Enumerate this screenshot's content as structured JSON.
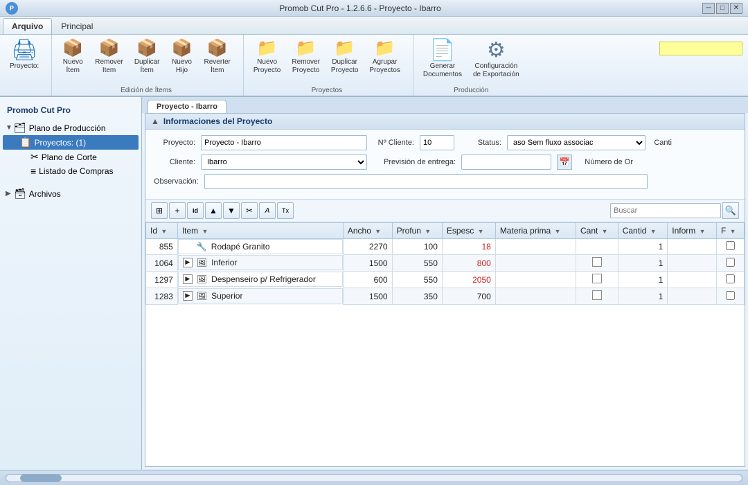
{
  "titleBar": {
    "title": "Promob Cut Pro - 1.2.6.6 - Proyecto - Ibarro",
    "logo": "P",
    "controls": {
      "minimize": "─",
      "restore": "□",
      "close": "✕"
    }
  },
  "menuBar": {
    "tabs": [
      {
        "id": "arquivo",
        "label": "Arquivo",
        "active": true
      },
      {
        "id": "principal",
        "label": "Principal",
        "active": false
      }
    ]
  },
  "ribbon": {
    "sections": [
      {
        "id": "imprimir",
        "label": "",
        "buttons": [
          {
            "id": "imprimir",
            "icon": "🖨",
            "label": "Imprimir",
            "large": true
          }
        ]
      },
      {
        "id": "edicao-items",
        "label": "Edición de Ítems",
        "buttons": [
          {
            "id": "novo-item",
            "icon": "📦",
            "label": "Nuevo\nÍtem"
          },
          {
            "id": "remover-item",
            "icon": "📦",
            "label": "Remover\nItem"
          },
          {
            "id": "duplicar-item",
            "icon": "📦",
            "label": "Duplicar\nÍtem"
          },
          {
            "id": "novo-filho",
            "icon": "📦",
            "label": "Nuevo\nHijo"
          },
          {
            "id": "reverter-item",
            "icon": "📦",
            "label": "Reverter\nÍtem"
          }
        ]
      },
      {
        "id": "proyectos",
        "label": "Proyectos",
        "buttons": [
          {
            "id": "nuevo-proyecto",
            "icon": "📁",
            "label": "Nuevo\nProyecto"
          },
          {
            "id": "remover-proyecto",
            "icon": "📁",
            "label": "Remover\nProyecto"
          },
          {
            "id": "duplicar-proyecto",
            "icon": "📁",
            "label": "Duplicar\nProyecto"
          },
          {
            "id": "agrupar-proyectos",
            "icon": "📁",
            "label": "Agrupar\nProyectos"
          }
        ]
      },
      {
        "id": "produccion",
        "label": "Producción",
        "buttons": [
          {
            "id": "generar-documentos",
            "icon": "📄",
            "label": "Generar\nDocumentos",
            "large": true
          },
          {
            "id": "configuracion-exportacion",
            "icon": "⚙",
            "label": "Configuración\nde Exportación",
            "large": true
          }
        ]
      }
    ],
    "searchPlaceholder": "",
    "searchBg": "#ffff99"
  },
  "sidebar": {
    "title": "Promob Cut Pro",
    "tree": [
      {
        "id": "plano-produccion",
        "label": "Plano de Producción",
        "indent": 0,
        "arrow": "▼",
        "icon": "🗂"
      },
      {
        "id": "proyectos",
        "label": "Proyectos: (1)",
        "indent": 1,
        "arrow": "",
        "icon": "📋",
        "selected": true
      },
      {
        "id": "plano-corte",
        "label": "Plano de Corte",
        "indent": 2,
        "arrow": "",
        "icon": "✂"
      },
      {
        "id": "listado-compras",
        "label": "Listado de Compras",
        "indent": 2,
        "arrow": "",
        "icon": "≡"
      },
      {
        "id": "archivos",
        "label": "Archivos",
        "indent": 0,
        "arrow": "▶",
        "icon": "🗃"
      }
    ]
  },
  "content": {
    "tabLabel": "Proyecto - Ibarro",
    "sectionTitle": "Informaciones del Proyecto",
    "form": {
      "projectLabel": "Proyecto:",
      "projectValue": "Proyecto - Ibarro",
      "clienteNumLabel": "Nº Cliente:",
      "clienteNumValue": "10",
      "statusLabel": "Status:",
      "statusValue": "aso Sem fluxo associac",
      "cantiLabel": "Canti",
      "clienteLabel": "Cliente:",
      "clienteValue": "Ibarro",
      "previsionLabel": "Previsión de entrega:",
      "numOrLabel": "Número de Or",
      "observacionLabel": "Observación:"
    },
    "toolbar": {
      "buttons": [
        {
          "id": "tb-grid",
          "icon": "⊞"
        },
        {
          "id": "tb-add",
          "icon": "+"
        },
        {
          "id": "tb-id",
          "icon": "id"
        },
        {
          "id": "tb-up",
          "icon": "▲"
        },
        {
          "id": "tb-down",
          "icon": "▼"
        },
        {
          "id": "tb-cut",
          "icon": "✂"
        },
        {
          "id": "tb-copy",
          "icon": "A"
        },
        {
          "id": "tb-paste",
          "icon": "Tx"
        }
      ],
      "searchPlaceholder": "Buscar"
    },
    "table": {
      "columns": [
        {
          "id": "id",
          "label": "Id"
        },
        {
          "id": "item",
          "label": "Item"
        },
        {
          "id": "ancho",
          "label": "Ancho"
        },
        {
          "id": "profun",
          "label": "Profun"
        },
        {
          "id": "espesc",
          "label": "Espesc"
        },
        {
          "id": "materia",
          "label": "Materia prima"
        },
        {
          "id": "cant1",
          "label": "Cant"
        },
        {
          "id": "cantid",
          "label": "Cantid"
        },
        {
          "id": "inform",
          "label": "Inform"
        },
        {
          "id": "f",
          "label": "F"
        }
      ],
      "rows": [
        {
          "id": "855",
          "expand": false,
          "item": "Rodapé Granito",
          "ancho": "2270",
          "profun": "100",
          "espesc": "18",
          "materia": "",
          "cant1": "",
          "cantid": "1",
          "inform": "",
          "f": false,
          "espesc_red": true
        },
        {
          "id": "1064",
          "expand": true,
          "item": "Inferior",
          "ancho": "1500",
          "profun": "550",
          "espesc": "800",
          "materia": "",
          "cant1": "",
          "cantid": "1",
          "inform": "",
          "f": false,
          "espesc_red": true
        },
        {
          "id": "1297",
          "expand": true,
          "item": "Despenseiro p/ Refrigerador",
          "ancho": "600",
          "profun": "550",
          "espesc": "2050",
          "materia": "",
          "cant1": "",
          "cantid": "1",
          "inform": "",
          "f": false,
          "espesc_red": true
        },
        {
          "id": "1283",
          "expand": true,
          "item": "Superior",
          "ancho": "1500",
          "profun": "350",
          "espesc": "700",
          "materia": "",
          "cant1": "",
          "cantid": "1",
          "inform": "",
          "f": false,
          "espesc_red": false
        }
      ]
    }
  },
  "statusBar": {}
}
